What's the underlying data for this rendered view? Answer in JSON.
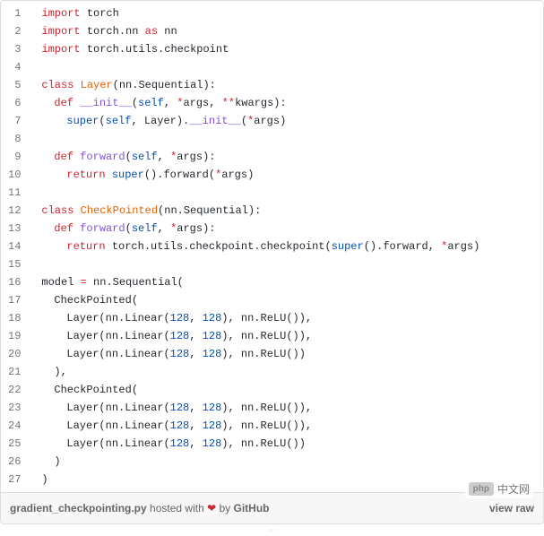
{
  "lines": [
    {
      "n": "1",
      "tokens": [
        [
          "kw",
          "import"
        ],
        [
          "pln",
          " torch"
        ]
      ]
    },
    {
      "n": "2",
      "tokens": [
        [
          "kw",
          "import"
        ],
        [
          "pln",
          " torch"
        ],
        [
          "pln",
          "."
        ],
        [
          "pln",
          "nn "
        ],
        [
          "kw",
          "as"
        ],
        [
          "pln",
          " nn"
        ]
      ]
    },
    {
      "n": "3",
      "tokens": [
        [
          "kw",
          "import"
        ],
        [
          "pln",
          " torch"
        ],
        [
          "pln",
          "."
        ],
        [
          "pln",
          "utils"
        ],
        [
          "pln",
          "."
        ],
        [
          "pln",
          "checkpoint"
        ]
      ]
    },
    {
      "n": "4",
      "tokens": []
    },
    {
      "n": "5",
      "tokens": [
        [
          "kw",
          "class"
        ],
        [
          "pln",
          " "
        ],
        [
          "cls",
          "Layer"
        ],
        [
          "pln",
          "("
        ],
        [
          "pln",
          "nn"
        ],
        [
          "pln",
          "."
        ],
        [
          "pln",
          "Sequential"
        ],
        [
          "pln",
          "):"
        ]
      ]
    },
    {
      "n": "6",
      "indent": 1,
      "tokens": [
        [
          "kw",
          "def"
        ],
        [
          "pln",
          " "
        ],
        [
          "fn",
          "__init__"
        ],
        [
          "pln",
          "("
        ],
        [
          "builtin",
          "self"
        ],
        [
          "pln",
          ", "
        ],
        [
          "op",
          "*"
        ],
        [
          "pln",
          "args"
        ],
        [
          "pln",
          ", "
        ],
        [
          "op",
          "**"
        ],
        [
          "pln",
          "kwargs"
        ],
        [
          "pln",
          "):"
        ]
      ]
    },
    {
      "n": "7",
      "indent": 2,
      "tokens": [
        [
          "builtin",
          "super"
        ],
        [
          "pln",
          "("
        ],
        [
          "builtin",
          "self"
        ],
        [
          "pln",
          ", "
        ],
        [
          "pln",
          "Layer"
        ],
        [
          "pln",
          ")."
        ],
        [
          "fn",
          "__init__"
        ],
        [
          "pln",
          "("
        ],
        [
          "op",
          "*"
        ],
        [
          "pln",
          "args"
        ],
        [
          "pln",
          ")"
        ]
      ]
    },
    {
      "n": "8",
      "tokens": []
    },
    {
      "n": "9",
      "indent": 1,
      "tokens": [
        [
          "kw",
          "def"
        ],
        [
          "pln",
          " "
        ],
        [
          "fn",
          "forward"
        ],
        [
          "pln",
          "("
        ],
        [
          "builtin",
          "self"
        ],
        [
          "pln",
          ", "
        ],
        [
          "op",
          "*"
        ],
        [
          "pln",
          "args"
        ],
        [
          "pln",
          "):"
        ]
      ]
    },
    {
      "n": "10",
      "indent": 2,
      "tokens": [
        [
          "kw",
          "return"
        ],
        [
          "pln",
          " "
        ],
        [
          "builtin",
          "super"
        ],
        [
          "pln",
          "()."
        ],
        [
          "pln",
          "forward"
        ],
        [
          "pln",
          "("
        ],
        [
          "op",
          "*"
        ],
        [
          "pln",
          "args"
        ],
        [
          "pln",
          ")"
        ]
      ]
    },
    {
      "n": "11",
      "tokens": []
    },
    {
      "n": "12",
      "tokens": [
        [
          "kw",
          "class"
        ],
        [
          "pln",
          " "
        ],
        [
          "cls",
          "CheckPointed"
        ],
        [
          "pln",
          "("
        ],
        [
          "pln",
          "nn"
        ],
        [
          "pln",
          "."
        ],
        [
          "pln",
          "Sequential"
        ],
        [
          "pln",
          "):"
        ]
      ]
    },
    {
      "n": "13",
      "indent": 1,
      "tokens": [
        [
          "kw",
          "def"
        ],
        [
          "pln",
          " "
        ],
        [
          "fn",
          "forward"
        ],
        [
          "pln",
          "("
        ],
        [
          "builtin",
          "self"
        ],
        [
          "pln",
          ", "
        ],
        [
          "op",
          "*"
        ],
        [
          "pln",
          "args"
        ],
        [
          "pln",
          "):"
        ]
      ]
    },
    {
      "n": "14",
      "indent": 2,
      "tokens": [
        [
          "kw",
          "return"
        ],
        [
          "pln",
          " torch"
        ],
        [
          "pln",
          "."
        ],
        [
          "pln",
          "utils"
        ],
        [
          "pln",
          "."
        ],
        [
          "pln",
          "checkpoint"
        ],
        [
          "pln",
          "."
        ],
        [
          "pln",
          "checkpoint"
        ],
        [
          "pln",
          "("
        ],
        [
          "builtin",
          "super"
        ],
        [
          "pln",
          "()."
        ],
        [
          "pln",
          "forward"
        ],
        [
          "pln",
          ", "
        ],
        [
          "op",
          "*"
        ],
        [
          "pln",
          "args"
        ],
        [
          "pln",
          ")"
        ]
      ]
    },
    {
      "n": "15",
      "tokens": []
    },
    {
      "n": "16",
      "tokens": [
        [
          "pln",
          "model "
        ],
        [
          "op",
          "="
        ],
        [
          "pln",
          " nn"
        ],
        [
          "pln",
          "."
        ],
        [
          "pln",
          "Sequential"
        ],
        [
          "pln",
          "("
        ]
      ]
    },
    {
      "n": "17",
      "indent": 1,
      "tokens": [
        [
          "pln",
          "CheckPointed"
        ],
        [
          "pln",
          "("
        ]
      ]
    },
    {
      "n": "18",
      "indent": 2,
      "tokens": [
        [
          "pln",
          "Layer"
        ],
        [
          "pln",
          "("
        ],
        [
          "pln",
          "nn"
        ],
        [
          "pln",
          "."
        ],
        [
          "pln",
          "Linear"
        ],
        [
          "pln",
          "("
        ],
        [
          "num",
          "128"
        ],
        [
          "pln",
          ", "
        ],
        [
          "num",
          "128"
        ],
        [
          "pln",
          "), "
        ],
        [
          "pln",
          "nn"
        ],
        [
          "pln",
          "."
        ],
        [
          "pln",
          "ReLU"
        ],
        [
          "pln",
          "()),"
        ]
      ]
    },
    {
      "n": "19",
      "indent": 2,
      "tokens": [
        [
          "pln",
          "Layer"
        ],
        [
          "pln",
          "("
        ],
        [
          "pln",
          "nn"
        ],
        [
          "pln",
          "."
        ],
        [
          "pln",
          "Linear"
        ],
        [
          "pln",
          "("
        ],
        [
          "num",
          "128"
        ],
        [
          "pln",
          ", "
        ],
        [
          "num",
          "128"
        ],
        [
          "pln",
          "), "
        ],
        [
          "pln",
          "nn"
        ],
        [
          "pln",
          "."
        ],
        [
          "pln",
          "ReLU"
        ],
        [
          "pln",
          "()),"
        ]
      ]
    },
    {
      "n": "20",
      "indent": 2,
      "tokens": [
        [
          "pln",
          "Layer"
        ],
        [
          "pln",
          "("
        ],
        [
          "pln",
          "nn"
        ],
        [
          "pln",
          "."
        ],
        [
          "pln",
          "Linear"
        ],
        [
          "pln",
          "("
        ],
        [
          "num",
          "128"
        ],
        [
          "pln",
          ", "
        ],
        [
          "num",
          "128"
        ],
        [
          "pln",
          "), "
        ],
        [
          "pln",
          "nn"
        ],
        [
          "pln",
          "."
        ],
        [
          "pln",
          "ReLU"
        ],
        [
          "pln",
          "())"
        ]
      ]
    },
    {
      "n": "21",
      "indent": 1,
      "tokens": [
        [
          "pln",
          "),"
        ]
      ]
    },
    {
      "n": "22",
      "indent": 1,
      "tokens": [
        [
          "pln",
          "CheckPointed"
        ],
        [
          "pln",
          "("
        ]
      ]
    },
    {
      "n": "23",
      "indent": 2,
      "tokens": [
        [
          "pln",
          "Layer"
        ],
        [
          "pln",
          "("
        ],
        [
          "pln",
          "nn"
        ],
        [
          "pln",
          "."
        ],
        [
          "pln",
          "Linear"
        ],
        [
          "pln",
          "("
        ],
        [
          "num",
          "128"
        ],
        [
          "pln",
          ", "
        ],
        [
          "num",
          "128"
        ],
        [
          "pln",
          "), "
        ],
        [
          "pln",
          "nn"
        ],
        [
          "pln",
          "."
        ],
        [
          "pln",
          "ReLU"
        ],
        [
          "pln",
          "()),"
        ]
      ]
    },
    {
      "n": "24",
      "indent": 2,
      "tokens": [
        [
          "pln",
          "Layer"
        ],
        [
          "pln",
          "("
        ],
        [
          "pln",
          "nn"
        ],
        [
          "pln",
          "."
        ],
        [
          "pln",
          "Linear"
        ],
        [
          "pln",
          "("
        ],
        [
          "num",
          "128"
        ],
        [
          "pln",
          ", "
        ],
        [
          "num",
          "128"
        ],
        [
          "pln",
          "), "
        ],
        [
          "pln",
          "nn"
        ],
        [
          "pln",
          "."
        ],
        [
          "pln",
          "ReLU"
        ],
        [
          "pln",
          "()),"
        ]
      ]
    },
    {
      "n": "25",
      "indent": 2,
      "tokens": [
        [
          "pln",
          "Layer"
        ],
        [
          "pln",
          "("
        ],
        [
          "pln",
          "nn"
        ],
        [
          "pln",
          "."
        ],
        [
          "pln",
          "Linear"
        ],
        [
          "pln",
          "("
        ],
        [
          "num",
          "128"
        ],
        [
          "pln",
          ", "
        ],
        [
          "num",
          "128"
        ],
        [
          "pln",
          "), "
        ],
        [
          "pln",
          "nn"
        ],
        [
          "pln",
          "."
        ],
        [
          "pln",
          "ReLU"
        ],
        [
          "pln",
          "())"
        ]
      ]
    },
    {
      "n": "26",
      "indent": 1,
      "tokens": [
        [
          "pln",
          ")"
        ]
      ]
    },
    {
      "n": "27",
      "tokens": [
        [
          "pln",
          ")"
        ]
      ]
    }
  ],
  "meta": {
    "filename": "gradient_checkpointing.py",
    "hosted_with": " hosted with ",
    "heart": "❤",
    "by": " by ",
    "host": "GitHub",
    "view_raw": "view raw"
  },
  "logo": {
    "badge": "php",
    "text": "中文网"
  }
}
